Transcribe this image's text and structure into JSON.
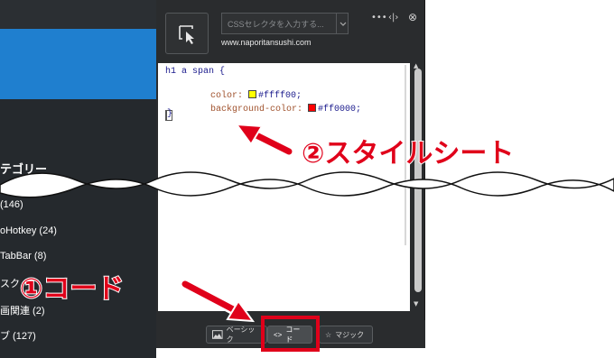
{
  "background_page": {
    "category_heading": "テゴリー",
    "categories": [
      "(146)",
      "oHotkey (24)",
      "TabBar (8)",
      "スク",
      "画関連 (2)",
      "ブ (127)"
    ]
  },
  "panel": {
    "css_selector_placeholder": "CSSセレクタを入力する...",
    "domain": "www.naporitansushi.com",
    "controls": {
      "more": "•••",
      "split": "‹|›",
      "close": "⊗"
    }
  },
  "editor": {
    "lines": [
      {
        "type": "selector",
        "text": "h1 a span {"
      },
      {
        "type": "prop",
        "prop": "color: ",
        "swatch": "#ffff00",
        "value": "#ffff00;"
      },
      {
        "type": "prop",
        "prop": "background-color: ",
        "swatch": "#ff0000",
        "value": "#ff0000;"
      },
      {
        "type": "close",
        "text": "}"
      }
    ]
  },
  "tabs": [
    {
      "label": "ベーシック",
      "icon": "image-icon"
    },
    {
      "label": "コード",
      "icon": "code-icon",
      "active": true
    },
    {
      "label": "マジック",
      "icon": "star-icon"
    }
  ],
  "annotations": {
    "stylesheet": "②スタイルシート",
    "code": "①コード"
  },
  "colors": {
    "annotation_red": "#e0001a",
    "banner_blue": "#1f7fcf"
  }
}
